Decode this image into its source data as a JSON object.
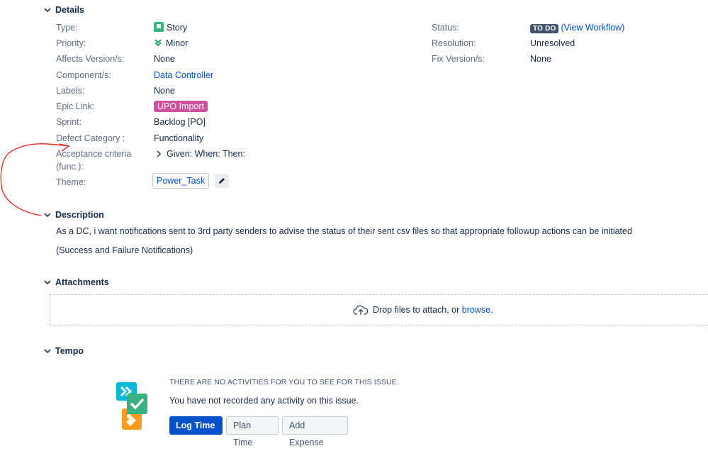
{
  "details": {
    "title": "Details",
    "left_fields": [
      {
        "label": "Type:",
        "value": "Story"
      },
      {
        "label": "Priority:",
        "value": "Minor"
      },
      {
        "label": "Affects Version/s:",
        "value": "None"
      },
      {
        "label": "Component/s:",
        "value": "Data Controller"
      },
      {
        "label": "Labels:",
        "value": "None"
      },
      {
        "label": "Epic Link:",
        "value": "UPO Import"
      },
      {
        "label": "Sprint:",
        "value": "Backlog [PO]"
      },
      {
        "label": "Defect Category :",
        "value": "Functionality"
      },
      {
        "label": "Acceptance criteria",
        "label2": "(func.):",
        "value": "Given: When: Then:"
      },
      {
        "label": "Theme:",
        "value": "Power_Task"
      }
    ],
    "right_fields": [
      {
        "label": "Status:",
        "value": "TO DO",
        "extra_open": "(",
        "extra_link": "View Workflow",
        "extra_close": ")"
      },
      {
        "label": "Resolution:",
        "value": "Unresolved"
      },
      {
        "label": "Fix Version/s:",
        "value": "None"
      }
    ]
  },
  "description": {
    "title": "Description",
    "paragraphs": [
      "As a DC, i want notifications sent to 3rd party senders to advise the status of their sent csv files so that appropriate followup actions can be initiated",
      "(Success and Failure Notifications)"
    ]
  },
  "attachments": {
    "title": "Attachments",
    "drop_text": "Drop files to attach, or",
    "browse_link": "browse",
    "drop_suffix": "."
  },
  "tempo": {
    "title": "Tempo",
    "heading": "THERE ARE NO ACTIVITIES FOR YOU TO SEE FOR THIS ISSUE.",
    "message": "You have not recorded any activity on this issue.",
    "buttons": {
      "log_time": "Log Time",
      "plan_time": "Plan Time",
      "add_expense": "Add Expense"
    }
  },
  "colors": {
    "link": "#0052cc",
    "epic": "#cd519d",
    "status": "#42526e",
    "annotation": "#e0201a"
  }
}
